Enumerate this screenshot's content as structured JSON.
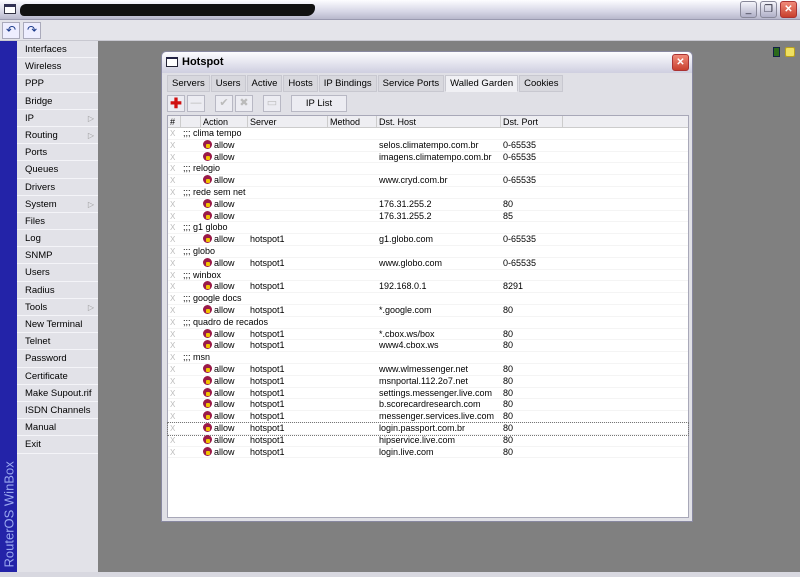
{
  "app": {
    "sidebar_label": "RouterOS WinBox"
  },
  "window_controls": {
    "minimize": "_",
    "restore": "❐",
    "close": "✕"
  },
  "toolbar": {
    "undo": "↶",
    "redo": "↷"
  },
  "menu": [
    {
      "label": "Interfaces"
    },
    {
      "label": "Wireless"
    },
    {
      "label": "PPP"
    },
    {
      "label": "Bridge"
    },
    {
      "label": "IP",
      "submenu": true
    },
    {
      "label": "Routing",
      "submenu": true
    },
    {
      "label": "Ports"
    },
    {
      "label": "Queues"
    },
    {
      "label": "Drivers"
    },
    {
      "label": "System",
      "submenu": true
    },
    {
      "label": "Files"
    },
    {
      "label": "Log"
    },
    {
      "label": "SNMP"
    },
    {
      "label": "Users"
    },
    {
      "label": "Radius"
    },
    {
      "label": "Tools",
      "submenu": true
    },
    {
      "label": "New Terminal"
    },
    {
      "label": "Telnet"
    },
    {
      "label": "Password"
    },
    {
      "label": "Certificate"
    },
    {
      "label": "Make Supout.rif"
    },
    {
      "label": "ISDN Channels"
    },
    {
      "label": "Manual"
    },
    {
      "label": "Exit"
    }
  ],
  "dialog": {
    "title": "Hotspot",
    "close": "✕",
    "tabs": [
      "Servers",
      "Users",
      "Active",
      "Hosts",
      "IP Bindings",
      "Service Ports",
      "Walled Garden",
      "Cookies"
    ],
    "active_tab": "Walled Garden",
    "toolbar": {
      "add": "✚",
      "remove": "—",
      "enable": "✔",
      "disable": "✖",
      "comment": "▭",
      "ip_list": "IP List"
    },
    "columns": [
      "#",
      "",
      "Action",
      "Server",
      "Method",
      "Dst. Host",
      "Dst. Port"
    ],
    "rows": [
      {
        "comment": ";;; clima tempo"
      },
      {
        "action": "allow",
        "server": "",
        "host": "selos.climatempo.com.br",
        "port": "0-65535"
      },
      {
        "action": "allow",
        "server": "",
        "host": "imagens.climatempo.com.br",
        "port": "0-65535"
      },
      {
        "comment": ";;; relogio"
      },
      {
        "action": "allow",
        "server": "",
        "host": "www.cryd.com.br",
        "port": "0-65535"
      },
      {
        "comment": ";;; rede sem net"
      },
      {
        "action": "allow",
        "server": "",
        "host": "176.31.255.2",
        "port": "80"
      },
      {
        "action": "allow",
        "server": "",
        "host": "176.31.255.2",
        "port": "85"
      },
      {
        "comment": ";;; g1 globo"
      },
      {
        "action": "allow",
        "server": "hotspot1",
        "host": "g1.globo.com",
        "port": "0-65535"
      },
      {
        "comment": ";;; globo"
      },
      {
        "action": "allow",
        "server": "hotspot1",
        "host": "www.globo.com",
        "port": "0-65535"
      },
      {
        "comment": ";;; winbox"
      },
      {
        "action": "allow",
        "server": "hotspot1",
        "host": "192.168.0.1",
        "port": "8291"
      },
      {
        "comment": ";;; google docs"
      },
      {
        "action": "allow",
        "server": "hotspot1",
        "host": "*.google.com",
        "port": "80"
      },
      {
        "comment": ";;; quadro de recados"
      },
      {
        "action": "allow",
        "server": "hotspot1",
        "host": "*.cbox.ws/box",
        "port": "80"
      },
      {
        "action": "allow",
        "server": "hotspot1",
        "host": "www4.cbox.ws",
        "port": "80"
      },
      {
        "comment": ";;; msn"
      },
      {
        "action": "allow",
        "server": "hotspot1",
        "host": "www.wlmessenger.net",
        "port": "80"
      },
      {
        "action": "allow",
        "server": "hotspot1",
        "host": "msnportal.112.2o7.net",
        "port": "80"
      },
      {
        "action": "allow",
        "server": "hotspot1",
        "host": "settings.messenger.live.com",
        "port": "80"
      },
      {
        "action": "allow",
        "server": "hotspot1",
        "host": "b.scorecardresearch.com",
        "port": "80"
      },
      {
        "action": "allow",
        "server": "hotspot1",
        "host": "messenger.services.live.com",
        "port": "80"
      },
      {
        "action": "allow",
        "server": "hotspot1",
        "host": "login.passport.com.br",
        "port": "80",
        "selected": true
      },
      {
        "action": "allow",
        "server": "hotspot1",
        "host": "hipservice.live.com",
        "port": "80"
      },
      {
        "action": "allow",
        "server": "hotspot1",
        "host": "login.live.com",
        "port": "80"
      }
    ]
  }
}
